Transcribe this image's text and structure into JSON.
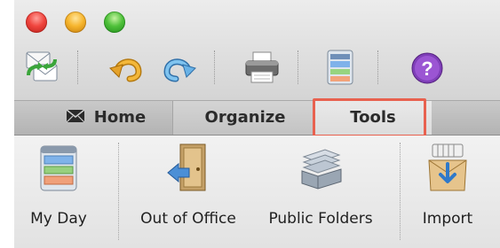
{
  "tabs": [
    {
      "label": "Home"
    },
    {
      "label": "Organize"
    },
    {
      "label": "Tools"
    }
  ],
  "toolbar": {
    "buttons": [
      "send-receive-icon",
      "undo-icon",
      "redo-icon",
      "print-icon",
      "my-day-icon",
      "help-icon"
    ]
  },
  "ribbon": {
    "buttons": [
      {
        "label": "My Day",
        "icon": "my-day-icon"
      },
      {
        "label": "Out of Office",
        "icon": "out-of-office-icon"
      },
      {
        "label": "Public Folders",
        "icon": "public-folders-icon"
      },
      {
        "label": "Import",
        "icon": "import-icon"
      }
    ]
  },
  "colors": {
    "highlight": "#e8614f",
    "selected_tab": "#e9e9e9"
  }
}
